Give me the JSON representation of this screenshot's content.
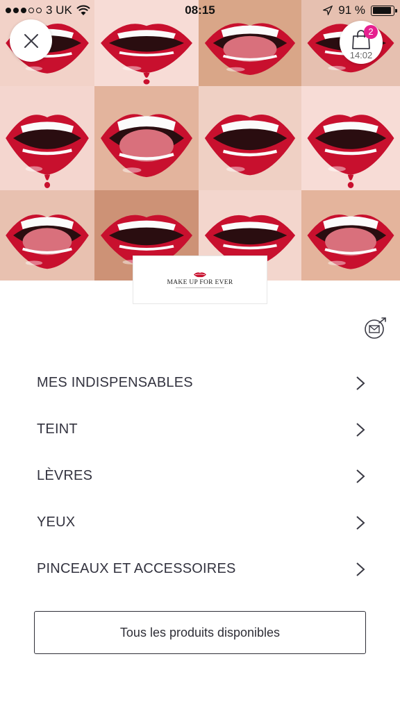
{
  "status_bar": {
    "carrier": "3 UK",
    "time": "08:15",
    "battery": "91 %",
    "battery_level": 0.91,
    "signal_bars_filled": 3,
    "signal_bars_total": 5
  },
  "header": {
    "close_icon": "close-icon",
    "bag_icon": "shopping-bag-icon",
    "bag_count": "2",
    "bag_timer": "14:02"
  },
  "brand": {
    "logo_text": "MAKE UP FOR EVER"
  },
  "newsletter_icon": "envelope-share-icon",
  "menu": {
    "items": [
      {
        "label": "MES INDISPENSABLES"
      },
      {
        "label": "TEINT"
      },
      {
        "label": "LÈVRES"
      },
      {
        "label": "YEUX"
      },
      {
        "label": "PINCEAUX ET ACCESSOIRES"
      }
    ]
  },
  "footer_button": {
    "label": "Tous les produits disponibles"
  },
  "colors": {
    "accent_badge": "#e6208f",
    "lip_red": "#c8102e",
    "skin": "#efcbbf",
    "text": "#33333f"
  }
}
